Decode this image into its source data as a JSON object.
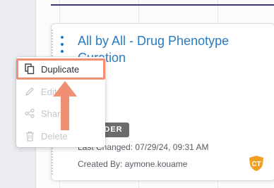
{
  "card": {
    "title": "All by All - Drug Phenotype Curation",
    "badge": "FOLDER",
    "last_changed": "Last Changed: 07/29/24, 09:31 AM",
    "created_by": "Created By: aymone.kouame",
    "owner_initials": "CT"
  },
  "menu": {
    "items": [
      {
        "label": "Duplicate",
        "icon": "duplicate-icon",
        "enabled": true
      },
      {
        "label": "Edit",
        "icon": "pencil-icon",
        "enabled": false
      },
      {
        "label": "Share",
        "icon": "share-icon",
        "enabled": false
      },
      {
        "label": "Delete",
        "icon": "trash-icon",
        "enabled": false
      }
    ]
  },
  "colors": {
    "title": "#2a7abf",
    "highlight": "#f08f71",
    "badge_bg": "#6c6c6c",
    "owner_badge": "#f0a020",
    "header_line": "#39396d"
  }
}
